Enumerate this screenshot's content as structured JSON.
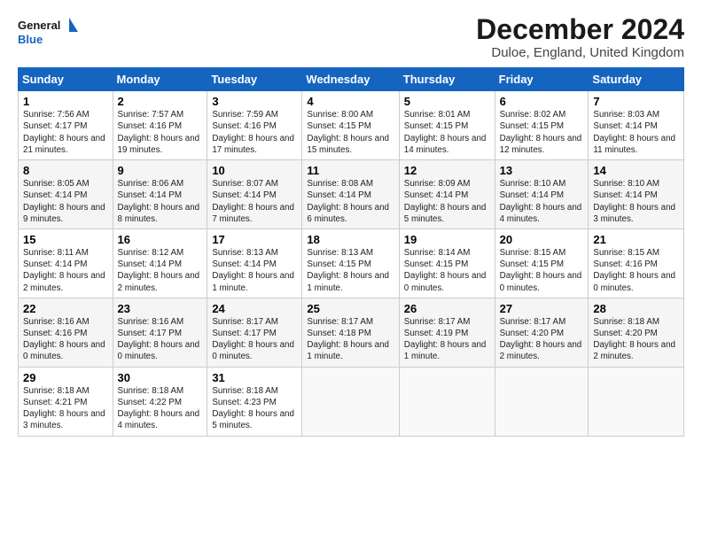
{
  "logo": {
    "line1": "General",
    "line2": "Blue"
  },
  "title": "December 2024",
  "subtitle": "Duloe, England, United Kingdom",
  "days_of_week": [
    "Sunday",
    "Monday",
    "Tuesday",
    "Wednesday",
    "Thursday",
    "Friday",
    "Saturday"
  ],
  "weeks": [
    [
      {
        "num": "1",
        "sunrise": "7:56 AM",
        "sunset": "4:17 PM",
        "daylight": "8 hours and 21 minutes."
      },
      {
        "num": "2",
        "sunrise": "7:57 AM",
        "sunset": "4:16 PM",
        "daylight": "8 hours and 19 minutes."
      },
      {
        "num": "3",
        "sunrise": "7:59 AM",
        "sunset": "4:16 PM",
        "daylight": "8 hours and 17 minutes."
      },
      {
        "num": "4",
        "sunrise": "8:00 AM",
        "sunset": "4:15 PM",
        "daylight": "8 hours and 15 minutes."
      },
      {
        "num": "5",
        "sunrise": "8:01 AM",
        "sunset": "4:15 PM",
        "daylight": "8 hours and 14 minutes."
      },
      {
        "num": "6",
        "sunrise": "8:02 AM",
        "sunset": "4:15 PM",
        "daylight": "8 hours and 12 minutes."
      },
      {
        "num": "7",
        "sunrise": "8:03 AM",
        "sunset": "4:14 PM",
        "daylight": "8 hours and 11 minutes."
      }
    ],
    [
      {
        "num": "8",
        "sunrise": "8:05 AM",
        "sunset": "4:14 PM",
        "daylight": "8 hours and 9 minutes."
      },
      {
        "num": "9",
        "sunrise": "8:06 AM",
        "sunset": "4:14 PM",
        "daylight": "8 hours and 8 minutes."
      },
      {
        "num": "10",
        "sunrise": "8:07 AM",
        "sunset": "4:14 PM",
        "daylight": "8 hours and 7 minutes."
      },
      {
        "num": "11",
        "sunrise": "8:08 AM",
        "sunset": "4:14 PM",
        "daylight": "8 hours and 6 minutes."
      },
      {
        "num": "12",
        "sunrise": "8:09 AM",
        "sunset": "4:14 PM",
        "daylight": "8 hours and 5 minutes."
      },
      {
        "num": "13",
        "sunrise": "8:10 AM",
        "sunset": "4:14 PM",
        "daylight": "8 hours and 4 minutes."
      },
      {
        "num": "14",
        "sunrise": "8:10 AM",
        "sunset": "4:14 PM",
        "daylight": "8 hours and 3 minutes."
      }
    ],
    [
      {
        "num": "15",
        "sunrise": "8:11 AM",
        "sunset": "4:14 PM",
        "daylight": "8 hours and 2 minutes."
      },
      {
        "num": "16",
        "sunrise": "8:12 AM",
        "sunset": "4:14 PM",
        "daylight": "8 hours and 2 minutes."
      },
      {
        "num": "17",
        "sunrise": "8:13 AM",
        "sunset": "4:14 PM",
        "daylight": "8 hours and 1 minute."
      },
      {
        "num": "18",
        "sunrise": "8:13 AM",
        "sunset": "4:15 PM",
        "daylight": "8 hours and 1 minute."
      },
      {
        "num": "19",
        "sunrise": "8:14 AM",
        "sunset": "4:15 PM",
        "daylight": "8 hours and 0 minutes."
      },
      {
        "num": "20",
        "sunrise": "8:15 AM",
        "sunset": "4:15 PM",
        "daylight": "8 hours and 0 minutes."
      },
      {
        "num": "21",
        "sunrise": "8:15 AM",
        "sunset": "4:16 PM",
        "daylight": "8 hours and 0 minutes."
      }
    ],
    [
      {
        "num": "22",
        "sunrise": "8:16 AM",
        "sunset": "4:16 PM",
        "daylight": "8 hours and 0 minutes."
      },
      {
        "num": "23",
        "sunrise": "8:16 AM",
        "sunset": "4:17 PM",
        "daylight": "8 hours and 0 minutes."
      },
      {
        "num": "24",
        "sunrise": "8:17 AM",
        "sunset": "4:17 PM",
        "daylight": "8 hours and 0 minutes."
      },
      {
        "num": "25",
        "sunrise": "8:17 AM",
        "sunset": "4:18 PM",
        "daylight": "8 hours and 1 minute."
      },
      {
        "num": "26",
        "sunrise": "8:17 AM",
        "sunset": "4:19 PM",
        "daylight": "8 hours and 1 minute."
      },
      {
        "num": "27",
        "sunrise": "8:17 AM",
        "sunset": "4:20 PM",
        "daylight": "8 hours and 2 minutes."
      },
      {
        "num": "28",
        "sunrise": "8:18 AM",
        "sunset": "4:20 PM",
        "daylight": "8 hours and 2 minutes."
      }
    ],
    [
      {
        "num": "29",
        "sunrise": "8:18 AM",
        "sunset": "4:21 PM",
        "daylight": "8 hours and 3 minutes."
      },
      {
        "num": "30",
        "sunrise": "8:18 AM",
        "sunset": "4:22 PM",
        "daylight": "8 hours and 4 minutes."
      },
      {
        "num": "31",
        "sunrise": "8:18 AM",
        "sunset": "4:23 PM",
        "daylight": "8 hours and 5 minutes."
      },
      null,
      null,
      null,
      null
    ]
  ],
  "labels": {
    "sunrise": "Sunrise:",
    "sunset": "Sunset:",
    "daylight": "Daylight:"
  }
}
